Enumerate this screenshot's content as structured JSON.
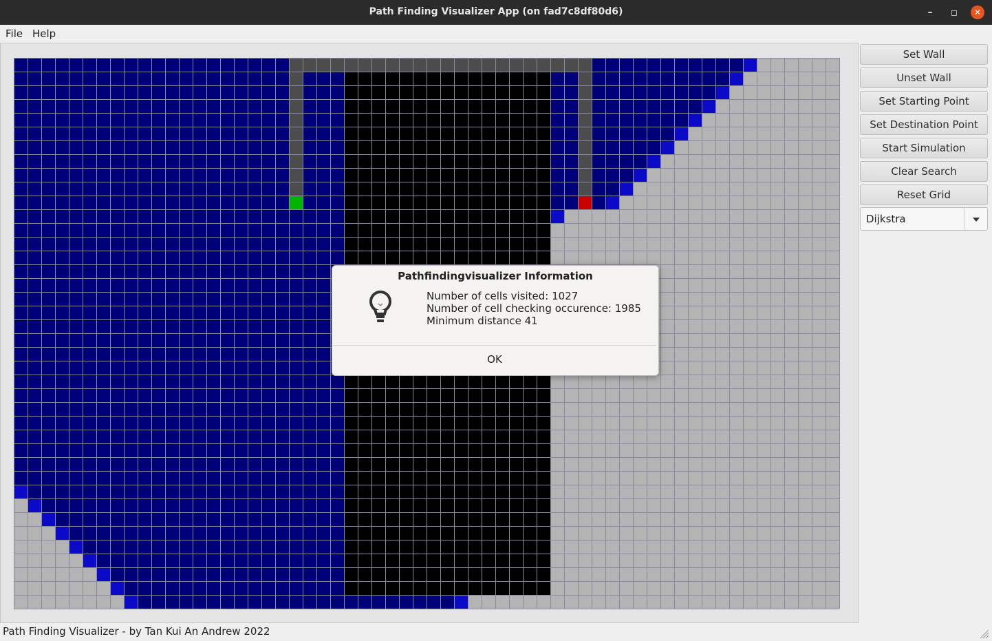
{
  "window": {
    "title": "Path Finding Visualizer App (on fad7c8df80d6)",
    "minimize_glyph": "–",
    "maximize_glyph": "◻",
    "close_glyph": "✕"
  },
  "menu": {
    "file": "File",
    "help": "Help"
  },
  "sidebar": {
    "buttons": [
      "Set Wall",
      "Unset Wall",
      "Set Starting Point",
      "Set Destination Point",
      "Start Simulation",
      "Clear Search",
      "Reset Grid"
    ],
    "algorithm": "Dijkstra"
  },
  "status": "Path Finding Visualizer - by Tan Kui An Andrew 2022",
  "dialog": {
    "title": "Pathfindingvisualizer Information",
    "icon": "lightbulb-icon",
    "lines": [
      "Number of cells visited: 1027",
      "Number of cell checking occurence: 1985",
      "Minimum distance 41"
    ],
    "ok": "OK"
  },
  "grid": {
    "cols": 60,
    "rows": 40,
    "start": {
      "col": 20,
      "row": 10
    },
    "destination": {
      "col": 41,
      "row": 10
    },
    "colors": {
      "empty": "#b4b4b4",
      "visited": "#00007a",
      "frontier": "#0a0ac8",
      "wall": "#000000",
      "path": "#4c4c4c",
      "start": "#00b400",
      "destination": "#c80000",
      "gridline": "#8a8a9a"
    }
  }
}
